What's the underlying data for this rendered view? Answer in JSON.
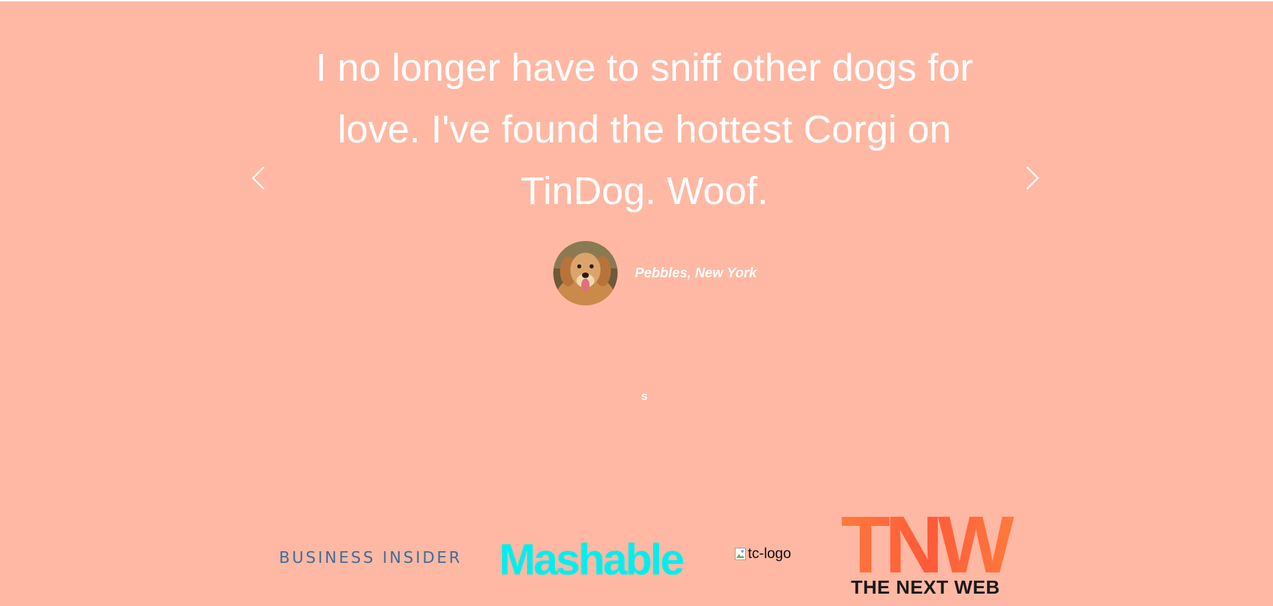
{
  "testimonial": {
    "quote": "I no longer have to sniff other dogs for love. I've found the hottest Corgi on TinDog. Woof.",
    "author": "Pebbles, New York",
    "avatar_icon": "golden-retriever-avatar",
    "indicator": "s",
    "prev_icon": "chevron-left-icon",
    "next_icon": "chevron-right-icon"
  },
  "press": {
    "business_insider": "BUSINESS INSIDER",
    "mashable": "Mashable",
    "techcrunch_alt": "tc-logo",
    "tnw_mark": "TNW",
    "tnw_name": "THE NEXT WEB"
  },
  "colors": {
    "background": "#ffb8a3",
    "text": "#ffffff",
    "business_insider": "#3e6e9b",
    "mashable": "#00eeee",
    "tnw": "#ff6a3d"
  }
}
